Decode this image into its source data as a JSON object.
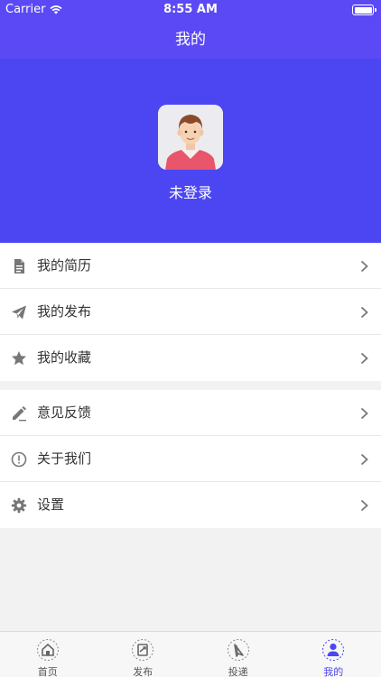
{
  "status_bar": {
    "carrier": "Carrier",
    "time": "8:55 AM"
  },
  "nav": {
    "title": "我的"
  },
  "profile": {
    "name": "未登录",
    "avatar_icon": "male-avatar-icon"
  },
  "menu": {
    "group1": [
      {
        "label": "我的简历",
        "icon": "document-icon"
      },
      {
        "label": "我的发布",
        "icon": "paper-plane-icon"
      },
      {
        "label": "我的收藏",
        "icon": "star-icon"
      }
    ],
    "group2": [
      {
        "label": "意见反馈",
        "icon": "pencil-icon"
      },
      {
        "label": "关于我们",
        "icon": "info-circle-icon"
      },
      {
        "label": "设置",
        "icon": "gear-icon"
      }
    ]
  },
  "tabs": [
    {
      "label": "首页",
      "icon": "home-icon"
    },
    {
      "label": "发布",
      "icon": "publish-icon"
    },
    {
      "label": "投递",
      "icon": "deliver-icon"
    },
    {
      "label": "我的",
      "icon": "user-icon",
      "active": true
    }
  ],
  "colors": {
    "header_bg": "#4b46f2",
    "active_tab": "#4b46f2",
    "page_bg": "#f2f2f2"
  }
}
